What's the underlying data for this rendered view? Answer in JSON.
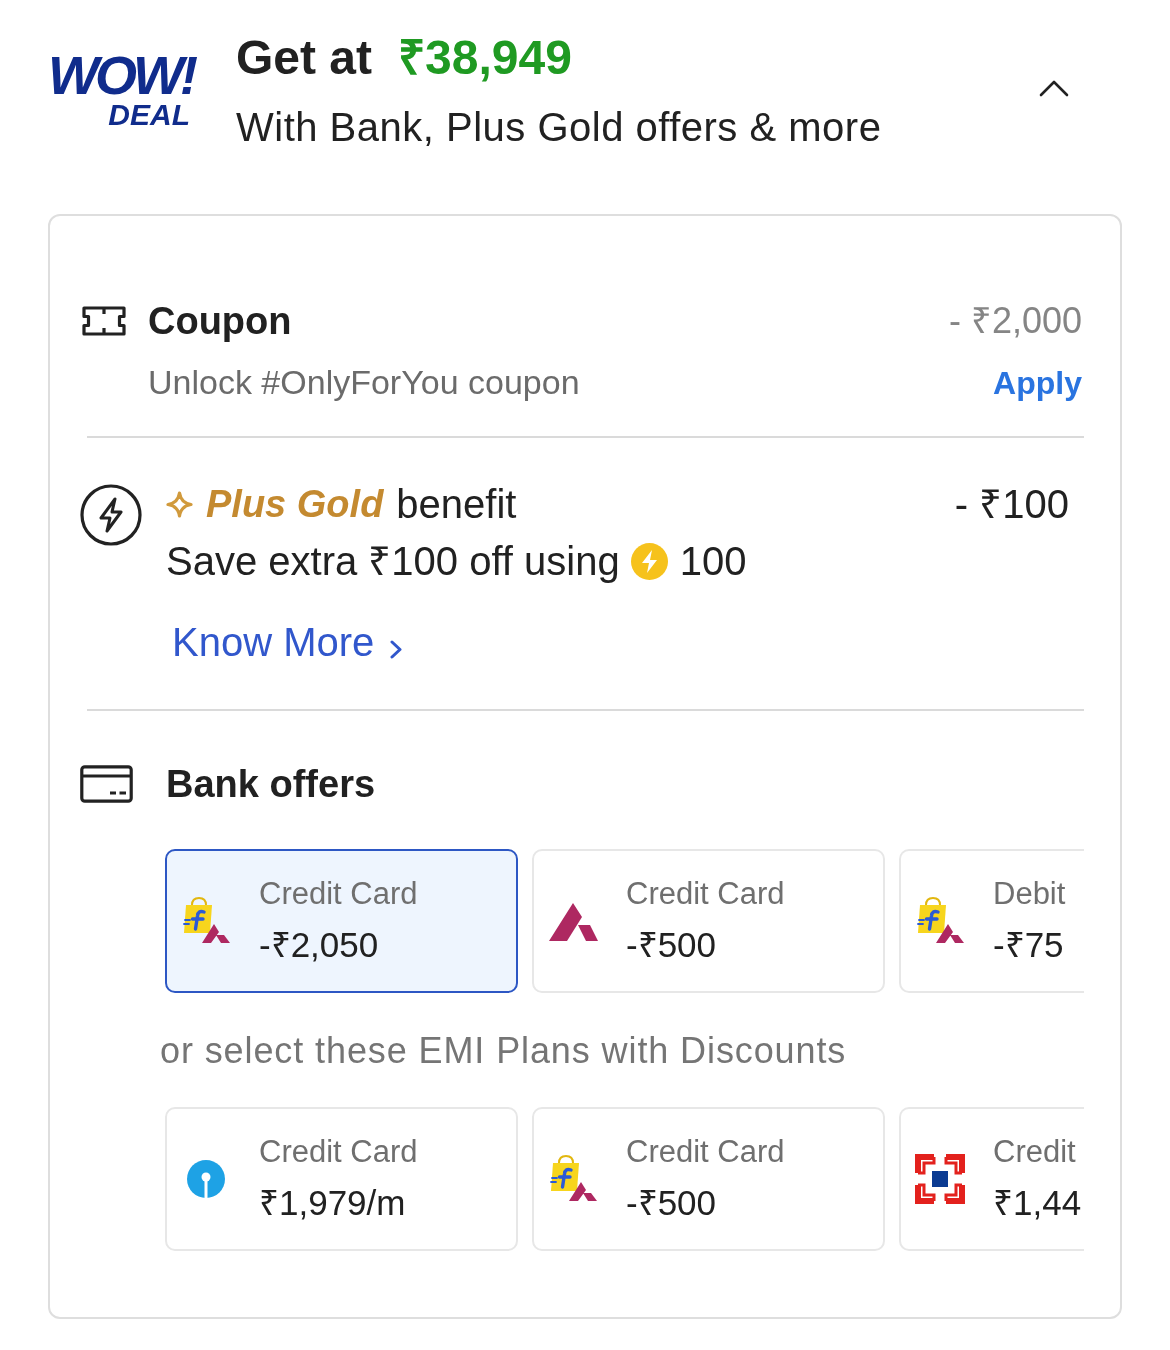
{
  "header": {
    "logo": {
      "line_1": "WOW!",
      "line_2": "DEAL"
    },
    "title": "Get at",
    "price": "₹38,949",
    "subtitle": "With Bank, Plus Gold offers & more",
    "expanded": true
  },
  "coupon": {
    "title": "Coupon",
    "amount": "- ₹2,000",
    "description": "Unlock #OnlyForYou coupon",
    "action": "Apply"
  },
  "plus_gold": {
    "brand": "Plus Gold",
    "title": "benefit",
    "amount": "- ₹100",
    "description": "Save extra ₹100 off using",
    "coins": "100",
    "link": "Know More"
  },
  "bank_offers": {
    "title": "Bank offers",
    "offers": [
      {
        "kind": "bag",
        "label": "Credit Card",
        "amount": "-₹2,050",
        "selected": true
      },
      {
        "kind": "peak",
        "label": "Credit Card",
        "amount": "-₹500",
        "selected": false
      },
      {
        "kind": "bag",
        "label": "Debit",
        "amount": "-₹75",
        "selected": false
      }
    ],
    "emi_label": "or select these EMI Plans with Discounts",
    "emi_plans": [
      {
        "kind": "keyhole",
        "label": "Credit Card",
        "amount": "₹1,979/m",
        "selected": false
      },
      {
        "kind": "bag",
        "label": "Credit Card",
        "amount": "-₹500",
        "selected": false
      },
      {
        "kind": "frame",
        "label": "Credit",
        "amount": "₹1,44",
        "selected": false
      }
    ]
  }
}
